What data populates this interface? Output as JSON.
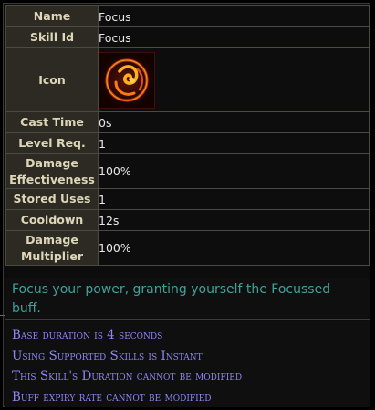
{
  "rows": {
    "name": {
      "key": "Name",
      "value": "Focus"
    },
    "skill_id": {
      "key": "Skill Id",
      "value": "Focus"
    },
    "icon": {
      "key": "Icon",
      "icon": "focus-skill-icon"
    },
    "cast_time": {
      "key": "Cast Time",
      "value": "0s"
    },
    "level_req": {
      "key": "Level Req.",
      "value": "1"
    },
    "damage_effectiveness": {
      "key_line1": "Damage",
      "key_line2": "Effectiveness",
      "value": "100%"
    },
    "stored_uses": {
      "key": "Stored Uses",
      "value": "1"
    },
    "cooldown": {
      "key": "Cooldown",
      "value": "12s"
    },
    "damage_multiplier": {
      "key_line1": "Damage",
      "key_line2": "Multiplier",
      "value": "100%"
    }
  },
  "description": "Focus your power, granting yourself the Focussed buff.",
  "stats": [
    "Base duration is 4 seconds",
    "Using Supported Skills is Instant",
    "This Skill's Duration cannot be modified",
    "Buff expiry rate cannot be modified"
  ],
  "colors": {
    "key_bg": "#2c2a22",
    "key_text": "#ddd6b8",
    "description_text": "#3fa29b",
    "stat_text": "#8d86f5"
  }
}
